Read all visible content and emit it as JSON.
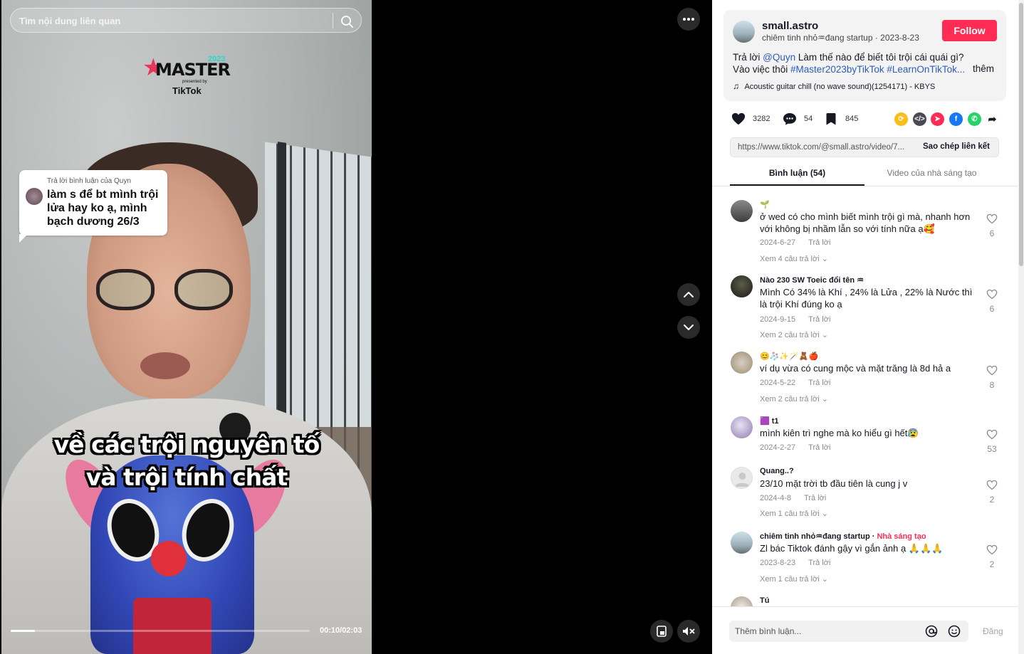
{
  "search": {
    "placeholder": "Tìm nội dung liên quan"
  },
  "video": {
    "logo": {
      "word": "MASTER",
      "year": "2023",
      "presented": "presented by",
      "brand": "TikTok"
    },
    "reply_bubble": {
      "title": "Trả lời bình luận của Quyn",
      "text": "làm s để bt mình trội lửa hay ko ạ, mình bạch dương 26/3"
    },
    "caption": [
      "về các trội nguyên tố",
      "và trội tính chất"
    ],
    "progress_fraction": 0.08,
    "time": "00:10/02:03"
  },
  "author": {
    "username": "small.astro",
    "subtitle": "chiêm tinh nhỏ♒︎đang startup · 2023-8-23",
    "follow_label": "Follow"
  },
  "description": {
    "line1_prefix": "Trả lời ",
    "line1_mention": "@Quyn",
    "line1_rest": " Làm thế nào để biết tôi trội cái quái gì?",
    "line2_text": "Vào việc thôi ",
    "line2_tag1": "#Master2023byTikTok",
    "line2_tag2": "#LearnOnTikTok...",
    "more": "thêm",
    "music": "Acoustic guitar chill (no wave sound)(1254171) - KBYS"
  },
  "stats": {
    "likes": "3282",
    "comments": "54",
    "saves": "845"
  },
  "link": {
    "url": "https://www.tiktok.com/@small.astro/video/7...",
    "copy_label": "Sao chép liên kết"
  },
  "tabs": {
    "comments": "Bình luận (54)",
    "videos": "Video của nhà sáng tạo"
  },
  "comments": [
    {
      "user": "🌱",
      "text": "ở wed có cho mình biết mình trội gì mà, nhanh hơn với không bị nhầm lẫn so với tính nữa ạ🥰",
      "date": "2024-6-27",
      "reply": "Trả lời",
      "more": "Xem 4 câu trả lời",
      "likes": "6"
    },
    {
      "user": "Nào 230 SW Toeic đổi tên ♒︎",
      "text": "Mình Có 34% là Khí , 24% là Lửa , 22% là Nước thì là trội Khí đúng ko ạ",
      "date": "2024-9-15",
      "reply": "Trả lời",
      "more": "Xem 2 câu trả lời",
      "likes": "6"
    },
    {
      "user": "😊🧦✨🪄🧸🍎",
      "text": "ví dụ vừa có cung mộc và mặt trăng là 8d hả a",
      "date": "2024-5-22",
      "reply": "Trả lời",
      "more": "Xem 2 câu trả lời",
      "likes": "8"
    },
    {
      "user": "🟪 t1",
      "text": "mình kiên trì nghe mà ko hiểu gì hết😰",
      "date": "2024-2-27",
      "reply": "Trả lời",
      "more": "",
      "likes": "53"
    },
    {
      "user": "Quang..?",
      "text": "23/10 mặt trời tb đầu tiên là cung j v",
      "date": "2024-4-8",
      "reply": "Trả lời",
      "more": "Xem 1 câu trả lời",
      "likes": "2"
    },
    {
      "user": "chiêm tinh nhỏ♒︎đang startup · ",
      "creator": "Nhà sáng tạo",
      "text": "Zl bác Tiktok đánh gậy vì gắn ảnh ạ 🙏🙏🙏",
      "date": "2023-8-23",
      "reply": "Trả lời",
      "more": "Xem 1 câu trả lời",
      "likes": "2"
    },
    {
      "user": "Tú",
      "text": "",
      "date": "",
      "reply": "",
      "more": "",
      "likes": ""
    }
  ],
  "comment_box": {
    "placeholder": "Thêm bình luận...",
    "post_label": "Đăng"
  },
  "colors": {
    "accent": "#fe2c55",
    "link": "#2b5db9"
  }
}
